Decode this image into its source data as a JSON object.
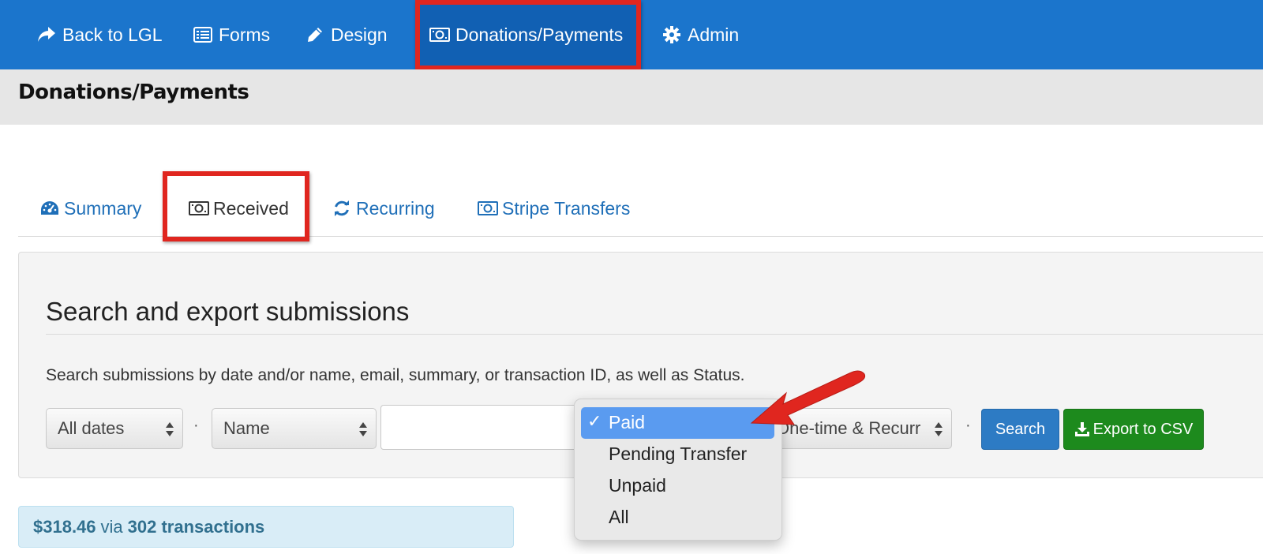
{
  "colors": {
    "nav_bg": "#1b75cc",
    "highlight": "#e0261f",
    "link": "#1f6fb8",
    "search_button": "#2d7bc4",
    "export_button": "#1d8a1d",
    "summary_bg": "#d9edf7"
  },
  "nav": {
    "items": [
      {
        "label": "Back to LGL",
        "icon": "share-arrow-icon"
      },
      {
        "label": "Forms",
        "icon": "list-icon"
      },
      {
        "label": "Design",
        "icon": "pencil-icon"
      },
      {
        "label": "Donations/Payments",
        "icon": "money-icon"
      },
      {
        "label": "Admin",
        "icon": "gear-icon"
      }
    ]
  },
  "page": {
    "title": "Donations/Payments"
  },
  "tabs": [
    {
      "label": "Summary",
      "icon": "dashboard-icon"
    },
    {
      "label": "Received",
      "icon": "money-icon"
    },
    {
      "label": "Recurring",
      "icon": "refresh-icon"
    },
    {
      "label": "Stripe Transfers",
      "icon": "money-icon"
    }
  ],
  "search": {
    "title": "Search and export submissions",
    "description": "Search submissions by date and/or name, email, summary, or transaction ID, as well as Status.",
    "date_select": "All dates",
    "field_select": "Name",
    "query_value": "",
    "type_select": "One-time & Recurr",
    "separator": "·",
    "search_label": "Search",
    "export_label": "Export to CSV"
  },
  "status_dropdown": {
    "selected": "Paid",
    "options": [
      "Paid",
      "Pending Transfer",
      "Unpaid",
      "All"
    ]
  },
  "summary": {
    "amount": "$318.46",
    "via": "via",
    "transactions": "302 transactions"
  }
}
